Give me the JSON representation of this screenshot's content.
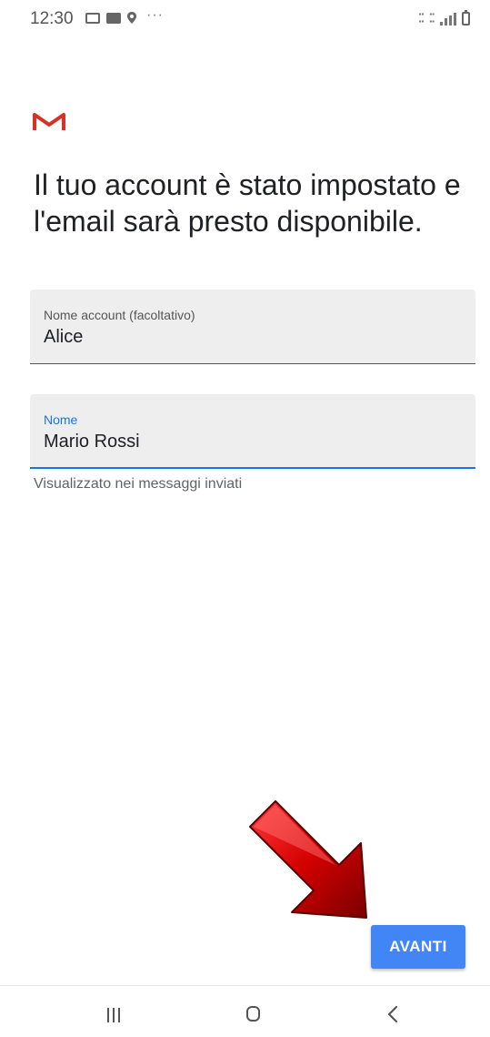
{
  "status_bar": {
    "time": "12:30",
    "left_icons": [
      "image-icon",
      "gallery-icon",
      "location-icon",
      "more-dots-icon"
    ],
    "right_icons": [
      "volte-icon",
      "4g-icon",
      "signal-icon",
      "battery-icon"
    ]
  },
  "app": {
    "logo": "gmail-logo",
    "brand_color": "#d93025"
  },
  "headline": "Il tuo account è stato impostato e l'email sarà presto disponibile.",
  "form": {
    "account_name": {
      "label": "Nome account (facoltativo)",
      "value": "Alice"
    },
    "name": {
      "label": "Nome",
      "value": "Mario Rossi",
      "helper": "Visualizzato nei messaggi inviati",
      "focused": true
    }
  },
  "actions": {
    "next_label": "AVANTI",
    "accent_color": "#4285f4"
  },
  "annotation": {
    "type": "red-arrow",
    "points_to": "next-button",
    "color": "#d40000"
  },
  "nav_bar": {
    "buttons": [
      "recents-icon",
      "home-icon",
      "back-icon"
    ]
  }
}
